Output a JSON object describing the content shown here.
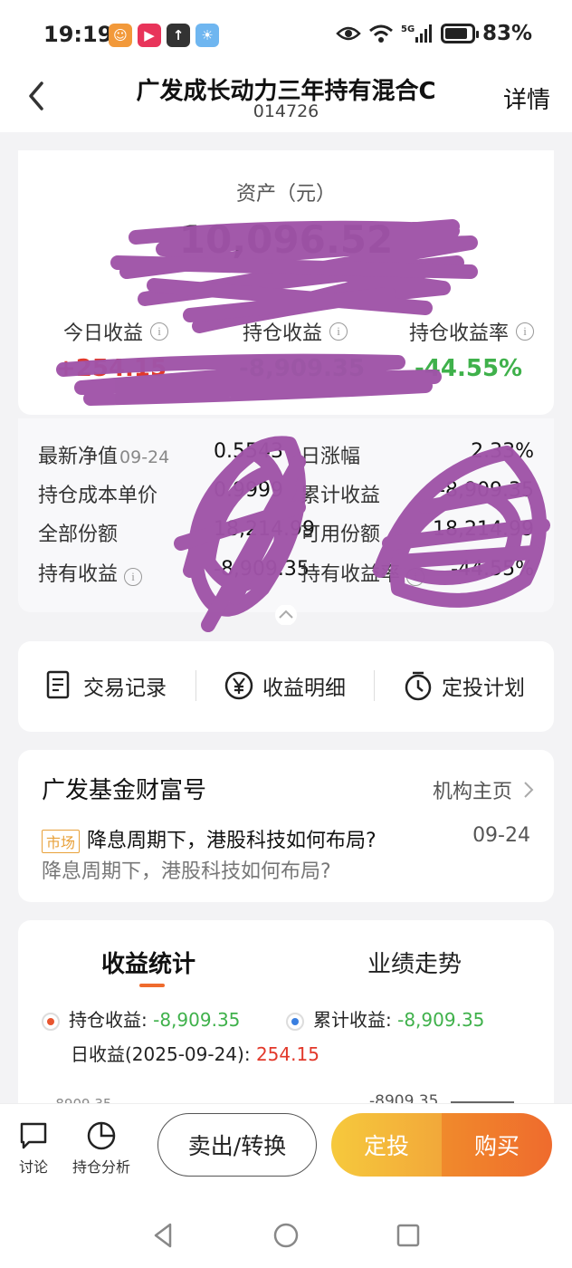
{
  "status_bar": {
    "time": "19:19",
    "battery": "83%",
    "network": "5G"
  },
  "header": {
    "title": "广发成长动力三年持有混合C",
    "fund_code": "014726",
    "detail_label": "详情"
  },
  "asset_card": {
    "asset_label": "资产（元）",
    "asset_value": "10,096.52",
    "metrics": [
      {
        "label": "今日收益",
        "value": "+254.15",
        "color": "#e2382a"
      },
      {
        "label": "持仓收益",
        "value": "-8,909.35",
        "color": "#3fb14b"
      },
      {
        "label": "持仓收益率",
        "value": "-44.55%",
        "color": "#3fb14b"
      }
    ]
  },
  "detail_grid": {
    "latest_nav_label": "最新净值",
    "latest_nav_date": "09-24",
    "latest_nav_value": "0.5543",
    "change_label": "日涨幅",
    "change_value": "2.33%",
    "cost_label": "持仓成本单价",
    "cost_value": "0.9999",
    "cum_income_label": "累计收益",
    "cum_income_value": "-8,909.35",
    "shares_label": "全部份额",
    "shares_value": "18,214.99",
    "available_label": "可用份额",
    "available_value": "18,214.99",
    "hold_income_label": "持有收益",
    "hold_income_value": "-8,909.35",
    "hold_rate_label": "持有收益率",
    "hold_rate_value": "-44.55%"
  },
  "actions": [
    {
      "label": "交易记录",
      "icon": "receipt-icon"
    },
    {
      "label": "收益明细",
      "icon": "yen-icon"
    },
    {
      "label": "定投计划",
      "icon": "timer-icon"
    }
  ],
  "news": {
    "source": "广发基金财富号",
    "link": "机构主页",
    "tag": "市场",
    "headline": "降息周期下，港股科技如何布局?",
    "date": "09-24",
    "summary": "降息周期下，港股科技如何布局?"
  },
  "stats": {
    "tabs": [
      "收益统计",
      "业绩走势"
    ],
    "active_tab": 0,
    "hold_income_label": "持仓收益:",
    "hold_income_value": "-8,909.35",
    "hold_color": "#e8552f",
    "cum_income_label": "累计收益:",
    "cum_income_value": "-8,909.35",
    "cum_color": "#3a7fe0",
    "daily_label": "日收益(2025-09-24):",
    "daily_value": "254.15",
    "chart_top_left": "-8909.35",
    "chart_top_right": "-8909.35"
  },
  "bottom_bar": {
    "discuss": "讨论",
    "analysis": "持仓分析",
    "sell": "卖出/转换",
    "sip": "定投",
    "buy": "购买"
  }
}
